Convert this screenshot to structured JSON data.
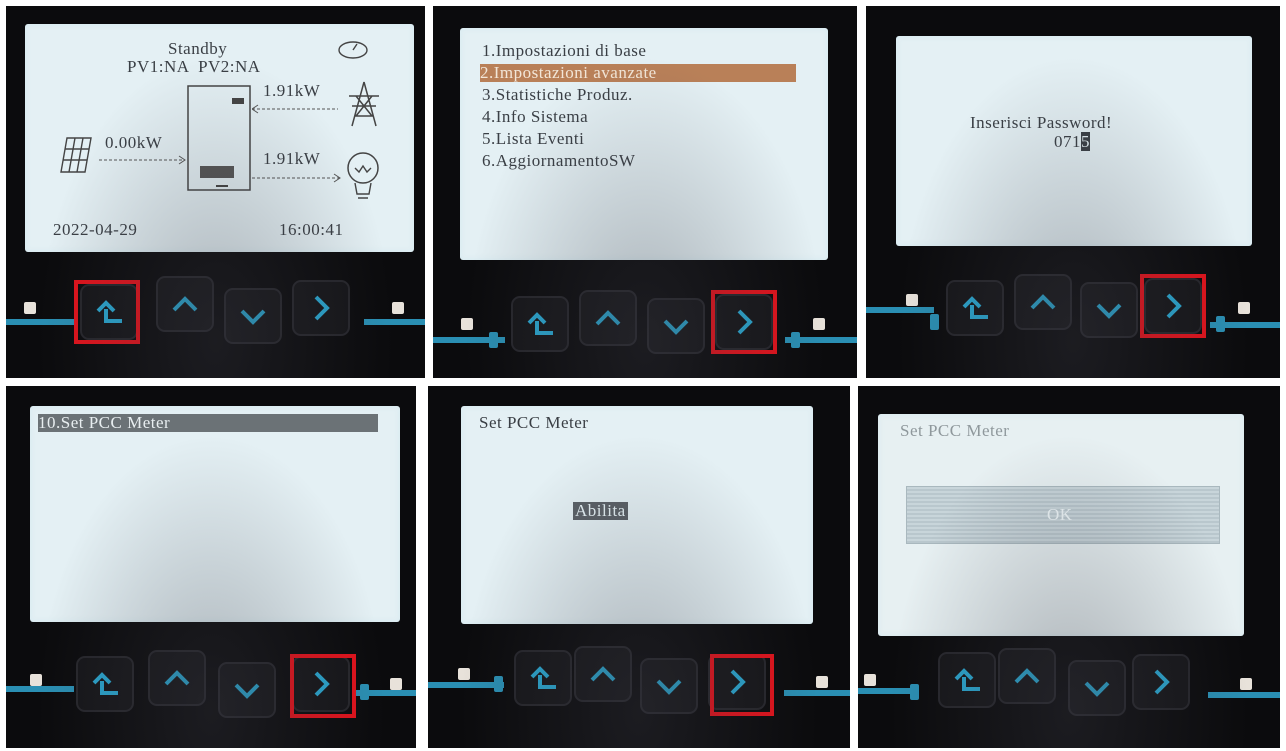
{
  "panels": {
    "p1": {
      "status": "Standby",
      "pv_status": "PV1:NA  PV2:NA",
      "grid_power": "1.91kW",
      "pv_power": "0.00kW",
      "load_power": "1.91kW",
      "date": "2022-04-29",
      "time": "16:00:41"
    },
    "p2": {
      "menu": [
        "1.Impostazioni di base",
        "2.Impostazioni avanzate",
        "3.Statistiche Produz.",
        "4.Info Sistema",
        "5.Lista Eventi",
        "6.AggiornamentoSW"
      ],
      "selected_index": 1
    },
    "p3": {
      "prompt": "Inserisci Password!",
      "password_prefix": "071",
      "password_cursor": "5"
    },
    "p4": {
      "menu_item": "10.Set PCC Meter"
    },
    "p5": {
      "title": "Set PCC Meter",
      "value": "Abilita"
    },
    "p6": {
      "title": "Set PCC Meter",
      "confirm": "OK"
    }
  },
  "buttons": [
    "back-up-icon",
    "up-icon",
    "down-icon",
    "right-icon"
  ],
  "highlighted_buttons": [
    "p1:back",
    "p2:enter",
    "p3:enter",
    "p4:enter",
    "p5:enter"
  ],
  "colors": {
    "highlight_box": "#e3121b",
    "button_icon": "#2aa6cf",
    "lcd_background": "#e4f0f4",
    "selection_bar": "#b98058"
  }
}
